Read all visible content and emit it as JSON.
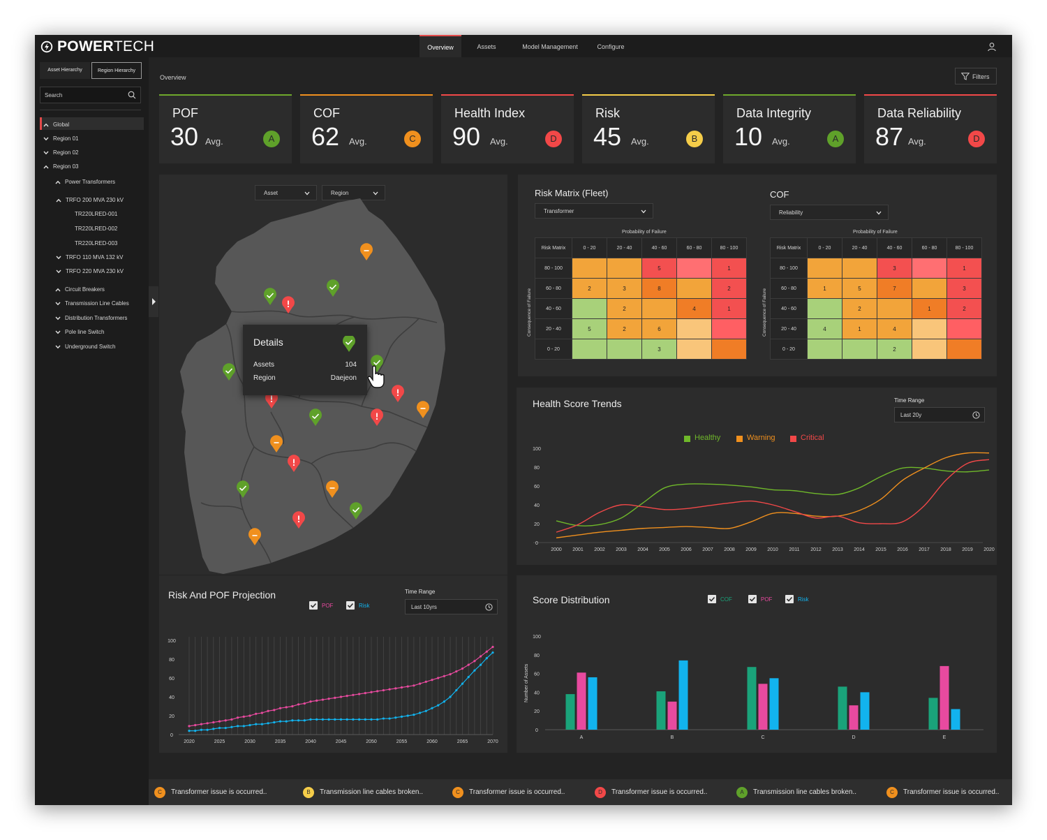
{
  "app": {
    "brand_bold": "POWER",
    "brand_light": "TECH"
  },
  "nav": {
    "tabs": [
      "Overview",
      "Assets",
      "Model Management",
      "Configure"
    ],
    "active": "Overview"
  },
  "sidebar": {
    "hier_buttons": [
      "Asset Hierarchy",
      "Region Hierarchy"
    ],
    "search_placeholder": "Search",
    "tree": [
      {
        "label": "Global",
        "chevron": "up"
      },
      {
        "label": "Region 01",
        "chevron": "down"
      },
      {
        "label": "Region 02",
        "chevron": "down"
      },
      {
        "label": "Region 03",
        "chevron": "up"
      },
      {
        "label": "Power Transformers",
        "chevron": "up"
      },
      {
        "label": "TRFO 200 MVA 230 kV",
        "chevron": "up"
      },
      {
        "label": "TR220LRED-001",
        "chevron": "none"
      },
      {
        "label": "TR220LRED-002",
        "chevron": "none"
      },
      {
        "label": "TR220LRED-003",
        "chevron": "none"
      },
      {
        "label": "TRFO 110 MVA 132 kV",
        "chevron": "down"
      },
      {
        "label": "TRFO 220 MVA 230 kV",
        "chevron": "down"
      },
      {
        "label": "Circuit Breakers",
        "chevron": "up"
      },
      {
        "label": "Transmission Line Cables",
        "chevron": "down"
      },
      {
        "label": "Distribution Transformers",
        "chevron": "down"
      },
      {
        "label": "Pole line Switch",
        "chevron": "down"
      },
      {
        "label": "Underground Switch",
        "chevron": "down"
      }
    ]
  },
  "main": {
    "breadcrumb": "Overview",
    "filters_label": "Filters"
  },
  "colors": {
    "green": "#5fa12a",
    "orange": "#f0901e",
    "red": "#f24848",
    "yellow": "#f5cd49",
    "pink": "#e84a9f",
    "cyan": "#12b3ee",
    "teal": "#1aa37a"
  },
  "kpis": [
    {
      "title": "POF",
      "value": "30",
      "avg": "Avg.",
      "grade": "A",
      "grade_color": "#5fa12a",
      "bar_color": "#6fa82b"
    },
    {
      "title": "COF",
      "value": "62",
      "avg": "Avg.",
      "grade": "C",
      "grade_color": "#f0901e",
      "bar_color": "#f0901e"
    },
    {
      "title": "Health Index",
      "value": "90",
      "avg": "Avg.",
      "grade": "D",
      "grade_color": "#f24848",
      "bar_color": "#f24848"
    },
    {
      "title": "Risk",
      "value": "45",
      "avg": "Avg.",
      "grade": "B",
      "grade_color": "#f5cd49",
      "bar_color": "#f5cd49"
    },
    {
      "title": "Data Integrity",
      "value": "10",
      "avg": "Avg.",
      "grade": "A",
      "grade_color": "#5fa12a",
      "bar_color": "#6fa82b"
    },
    {
      "title": "Data Reliability",
      "value": "87",
      "avg": "Avg.",
      "grade": "D",
      "grade_color": "#f24848",
      "bar_color": "#f24848"
    }
  ],
  "map": {
    "asset_select": "Asset",
    "region_select": "Region",
    "details": {
      "title": "Details",
      "assets_label": "Assets",
      "assets_value": "104",
      "region_label": "Region",
      "region_value": "Daejeon"
    },
    "markers": [
      {
        "status": "warning"
      },
      {
        "status": "healthy"
      },
      {
        "status": "healthy"
      },
      {
        "status": "critical"
      },
      {
        "status": "healthy"
      },
      {
        "status": "healthy"
      },
      {
        "status": "critical"
      },
      {
        "status": "critical"
      },
      {
        "status": "warning"
      },
      {
        "status": "healthy"
      },
      {
        "status": "critical"
      },
      {
        "status": "warning"
      },
      {
        "status": "critical"
      },
      {
        "status": "healthy"
      },
      {
        "status": "warning"
      },
      {
        "status": "healthy"
      },
      {
        "status": "critical"
      },
      {
        "status": "warning"
      }
    ]
  },
  "risk_matrix": {
    "title": "Risk Matrix (Fleet)",
    "select": "Transformer",
    "x_caption": "Probability of Failure",
    "y_caption": "Consequence of Failure",
    "corner": "Risk Matrix",
    "cols": [
      "0 - 20",
      "20 - 40",
      "40 - 60",
      "60 - 80",
      "80 - 100"
    ],
    "rows": [
      "80 - 100",
      "60 - 80",
      "40 - 60",
      "20 - 40",
      "0 - 20"
    ],
    "colors": [
      [
        "o",
        "o",
        "r",
        "p",
        "r"
      ],
      [
        "o",
        "o",
        "do",
        "o",
        "r"
      ],
      [
        "g",
        "o",
        "o",
        "do",
        "r"
      ],
      [
        "g",
        "o",
        "o",
        "lo",
        "pr"
      ],
      [
        "g",
        "g",
        "g",
        "lo",
        "do"
      ]
    ],
    "values": [
      [
        "",
        "",
        "5",
        "",
        "1"
      ],
      [
        "2",
        "3",
        "8",
        "",
        "2"
      ],
      [
        "",
        "2",
        "",
        "4",
        "1"
      ],
      [
        "5",
        "2",
        "6",
        "",
        ""
      ],
      [
        "",
        "",
        "3",
        "",
        ""
      ]
    ]
  },
  "cof_matrix": {
    "title": "COF",
    "select": "Reliability",
    "x_caption": "Probability of Failure",
    "y_caption": "Consequence of Failure",
    "corner": "Risk Matrix",
    "cols": [
      "0 - 20",
      "20 - 40",
      "40 - 60",
      "60 - 80",
      "80 - 100"
    ],
    "rows": [
      "80 - 100",
      "60 - 80",
      "40 - 60",
      "20 - 40",
      "0 - 20"
    ],
    "colors": [
      [
        "o",
        "o",
        "r",
        "p",
        "r"
      ],
      [
        "o",
        "o",
        "do",
        "o",
        "r"
      ],
      [
        "g",
        "o",
        "o",
        "do",
        "r"
      ],
      [
        "g",
        "o",
        "o",
        "lo",
        "pr"
      ],
      [
        "g",
        "g",
        "g",
        "lo",
        "do"
      ]
    ],
    "values": [
      [
        "",
        "",
        "3",
        "",
        "1"
      ],
      [
        "1",
        "5",
        "7",
        "",
        "3"
      ],
      [
        "",
        "2",
        "",
        "1",
        "2"
      ],
      [
        "4",
        "1",
        "4",
        "",
        ""
      ],
      [
        "",
        "",
        "2",
        "",
        ""
      ]
    ]
  },
  "health_trends": {
    "title": "Health Score Trends",
    "time_range_label": "Time Range",
    "time_range_value": "Last 20y",
    "chart_data": {
      "type": "line",
      "x": [
        2000,
        2001,
        2002,
        2003,
        2004,
        2005,
        2006,
        2007,
        2008,
        2009,
        2010,
        2011,
        2012,
        2013,
        2014,
        2015,
        2016,
        2017,
        2018,
        2019,
        2020
      ],
      "ylim": [
        0,
        100
      ],
      "yticks": [
        0,
        20,
        40,
        60,
        80,
        100
      ],
      "series": [
        {
          "name": "Healthy",
          "color": "#6fb82a",
          "values": [
            23,
            18,
            19,
            26,
            42,
            58,
            62,
            62,
            61,
            59,
            56,
            55,
            52,
            51,
            58,
            70,
            79,
            79,
            76,
            75,
            77
          ]
        },
        {
          "name": "Warning",
          "color": "#f0901e",
          "values": [
            5,
            8,
            11,
            13,
            15,
            16,
            17,
            16,
            15,
            22,
            31,
            31,
            28,
            28,
            34,
            46,
            66,
            79,
            90,
            95,
            95
          ]
        },
        {
          "name": "Critical",
          "color": "#f24848",
          "values": [
            11,
            19,
            32,
            40,
            38,
            35,
            36,
            39,
            42,
            44,
            40,
            33,
            26,
            28,
            21,
            20,
            22,
            39,
            66,
            84,
            88
          ]
        }
      ]
    }
  },
  "projection": {
    "title": "Risk And POF Projection",
    "legend_pof": "POF",
    "legend_risk": "Risk",
    "time_range_label": "Time Range",
    "time_range_value": "Last 10yrs",
    "chart_data": {
      "type": "line",
      "x": [
        2020,
        2021,
        2022,
        2023,
        2024,
        2025,
        2026,
        2027,
        2028,
        2029,
        2030,
        2031,
        2032,
        2033,
        2034,
        2035,
        2036,
        2037,
        2038,
        2039,
        2040,
        2041,
        2042,
        2043,
        2044,
        2045,
        2046,
        2047,
        2048,
        2049,
        2050,
        2051,
        2052,
        2053,
        2054,
        2055,
        2056,
        2057,
        2058,
        2059,
        2060,
        2061,
        2062,
        2063,
        2064,
        2065,
        2066,
        2067,
        2068,
        2069,
        2070
      ],
      "xticks": [
        2020,
        2025,
        2030,
        2035,
        2040,
        2045,
        2050,
        2055,
        2060,
        2065,
        2070
      ],
      "ylim": [
        0,
        100
      ],
      "yticks": [
        0,
        20,
        40,
        60,
        80,
        100
      ],
      "series": [
        {
          "name": "POF",
          "color": "#e84a9f",
          "values": [
            9,
            10,
            11,
            12,
            13,
            14,
            15,
            16,
            18,
            19,
            20,
            22,
            23,
            25,
            26,
            28,
            29,
            30,
            32,
            33,
            35,
            36,
            37,
            38,
            39,
            40,
            41,
            42,
            43,
            44,
            45,
            46,
            47,
            48,
            49,
            50,
            51,
            52,
            54,
            56,
            58,
            60,
            62,
            64,
            67,
            70,
            74,
            78,
            83,
            88,
            93
          ]
        },
        {
          "name": "Risk",
          "color": "#12b3ee",
          "values": [
            4,
            4,
            5,
            5,
            6,
            7,
            7,
            8,
            9,
            9,
            10,
            11,
            11,
            12,
            13,
            14,
            14,
            15,
            15,
            15,
            16,
            16,
            16,
            16,
            16,
            16,
            16,
            16,
            16,
            16,
            16,
            16,
            17,
            17,
            18,
            19,
            20,
            21,
            23,
            25,
            28,
            31,
            35,
            40,
            47,
            54,
            61,
            68,
            74,
            81,
            87
          ]
        }
      ]
    }
  },
  "score_distribution": {
    "title": "Score Distribution",
    "legend_cof": "COF",
    "legend_pof": "POF",
    "legend_risk": "Risk",
    "ylabel": "Number of Assets",
    "chart_data": {
      "type": "bar",
      "categories": [
        "A",
        "B",
        "C",
        "D",
        "E"
      ],
      "ylim": [
        0,
        100
      ],
      "yticks": [
        0,
        20,
        40,
        60,
        80,
        100
      ],
      "series": [
        {
          "name": "COF",
          "color": "#1aa37a",
          "values": [
            38,
            41,
            67,
            46,
            34
          ]
        },
        {
          "name": "POF",
          "color": "#e84a9f",
          "values": [
            61,
            30,
            49,
            26,
            68
          ]
        },
        {
          "name": "Risk",
          "color": "#12b3ee",
          "values": [
            56,
            74,
            55,
            40,
            22
          ]
        }
      ]
    }
  },
  "ticker": [
    {
      "grade": "C",
      "color": "#f0901e",
      "text": "Transformer issue is occurred.."
    },
    {
      "grade": "B",
      "color": "#f5cd49",
      "text": "Transmission line cables broken.."
    },
    {
      "grade": "C",
      "color": "#f0901e",
      "text": "Transformer issue is occurred.."
    },
    {
      "grade": "D",
      "color": "#f24848",
      "text": "Transformer issue is occurred.."
    },
    {
      "grade": "A",
      "color": "#5fa12a",
      "text": "Transmission line cables broken.."
    },
    {
      "grade": "C",
      "color": "#f0901e",
      "text": "Transformer issue is occurred.."
    }
  ]
}
